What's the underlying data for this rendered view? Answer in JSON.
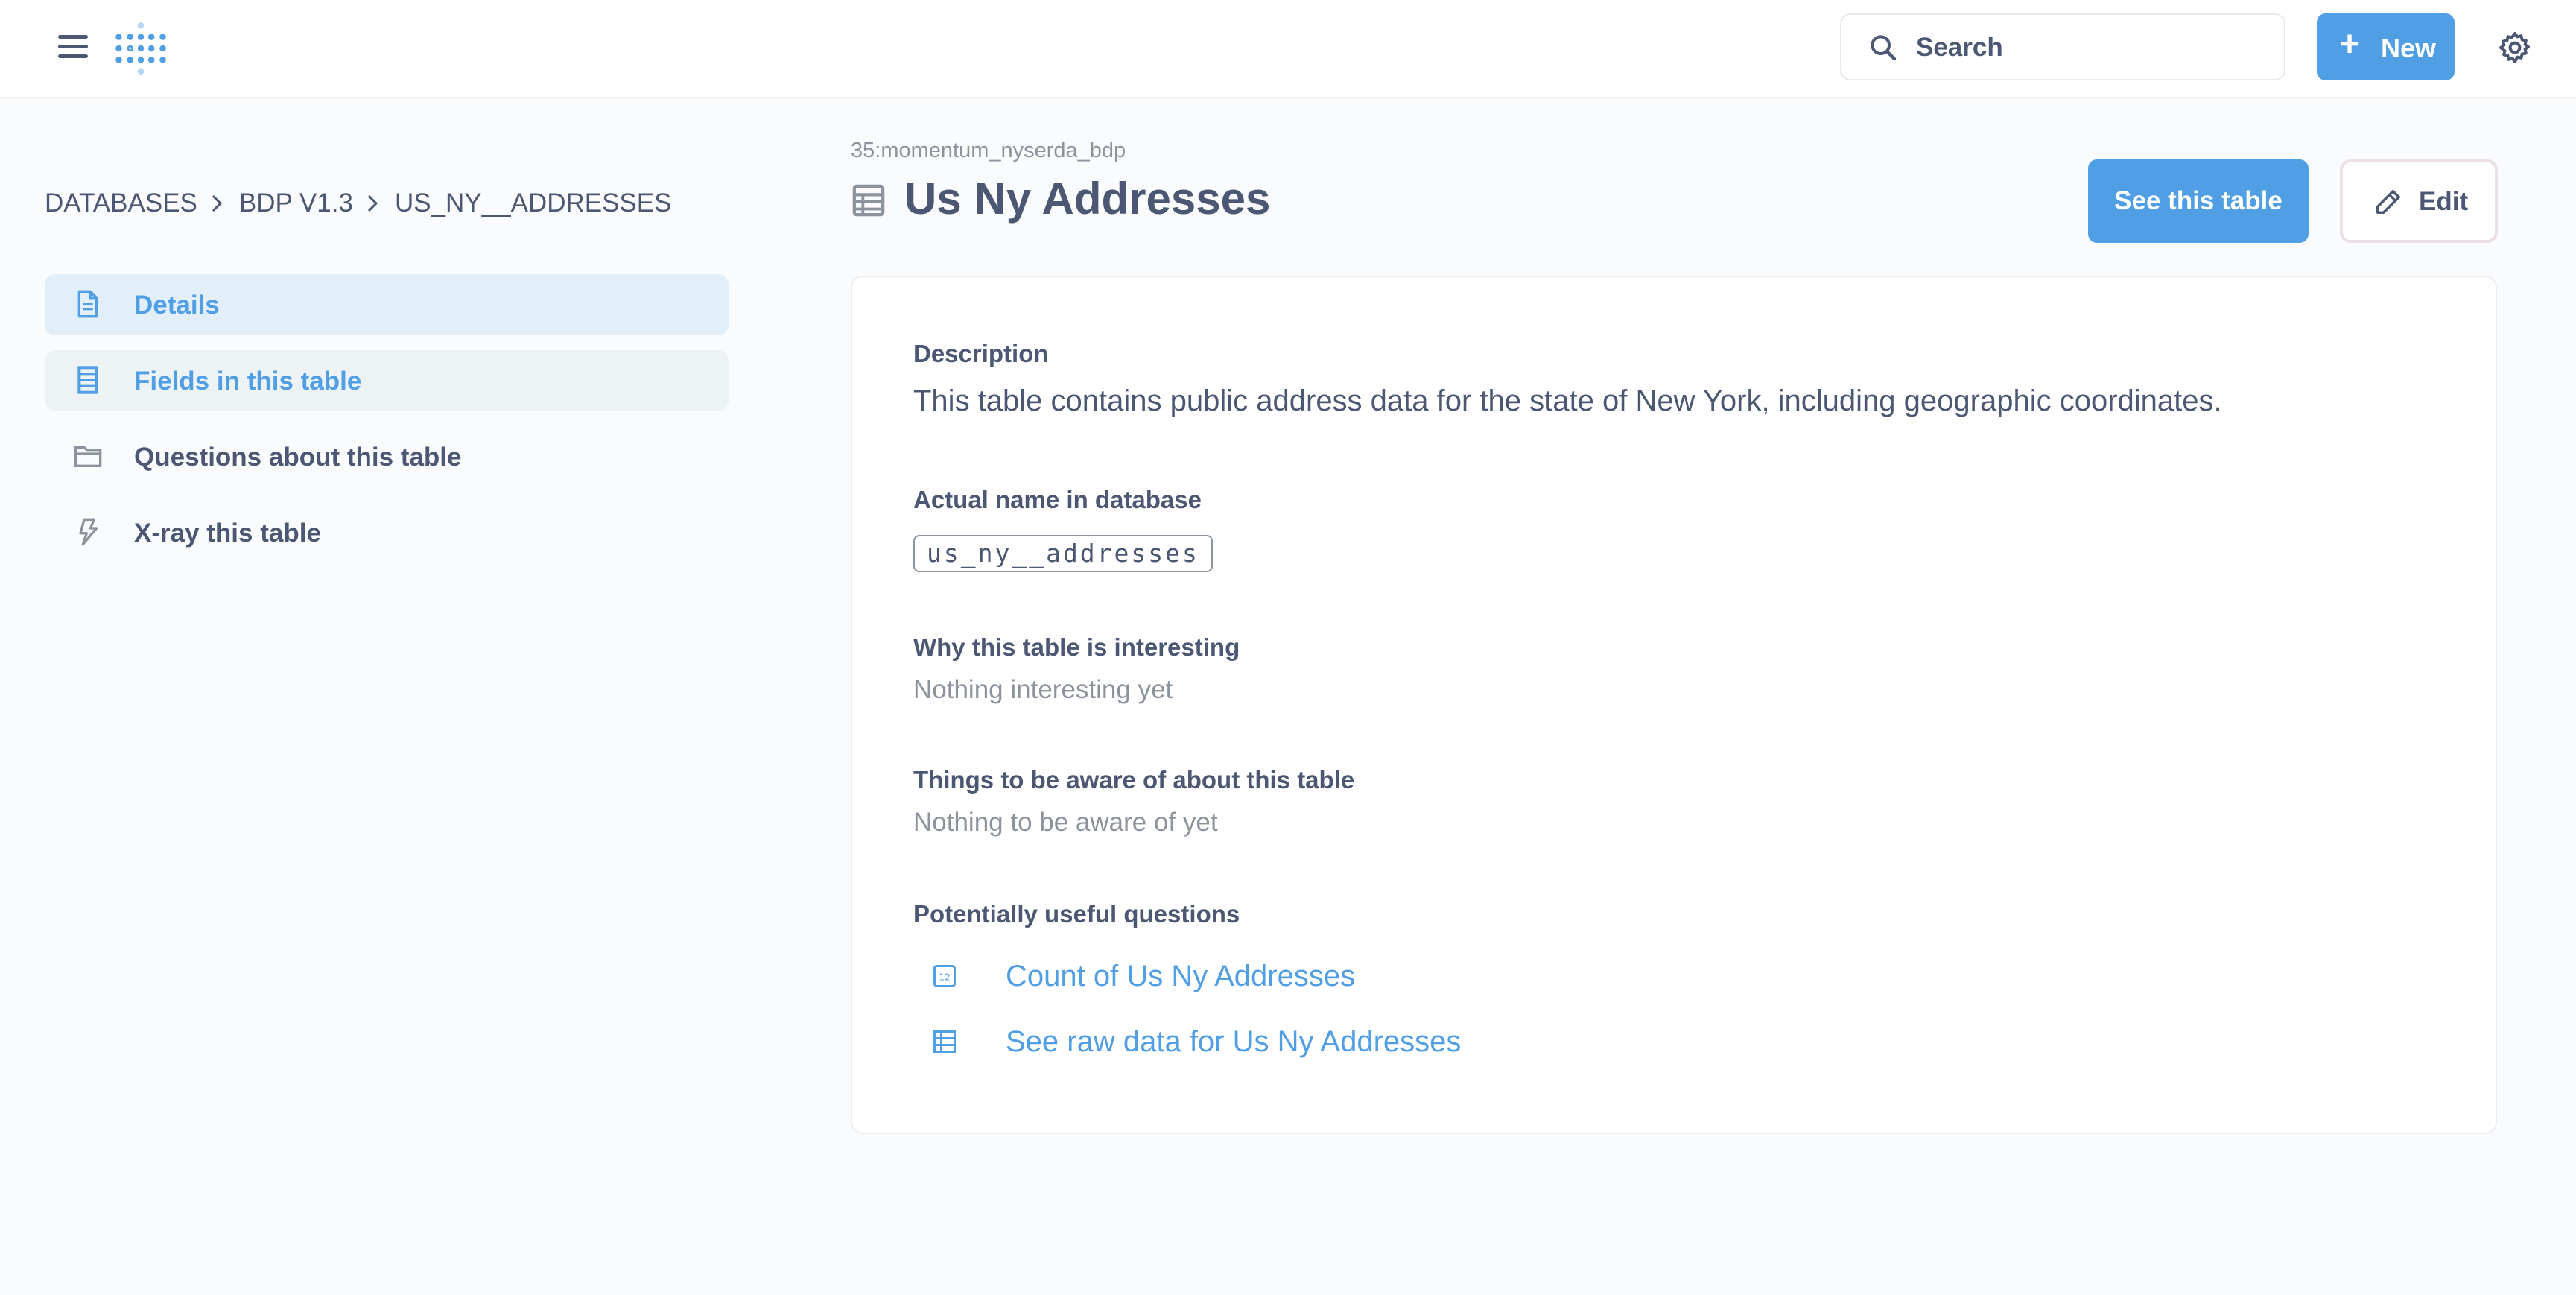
{
  "topbar": {
    "search_placeholder": "Search",
    "new_button": "New",
    "icons": {
      "menu": "hamburger-icon",
      "logo": "metabase-logo",
      "search": "search-icon",
      "add": "plus-icon",
      "settings": "gear-icon"
    }
  },
  "breadcrumb": {
    "items": [
      "DATABASES",
      "BDP V1.3",
      "US_NY__ADDRESSES"
    ]
  },
  "sidebar": {
    "items": [
      {
        "label": "Details",
        "icon": "document-icon",
        "state": "active"
      },
      {
        "label": "Fields in this table",
        "icon": "list-icon",
        "state": "hover"
      },
      {
        "label": "Questions about this table",
        "icon": "folder-icon",
        "state": "default"
      },
      {
        "label": "X-ray this table",
        "icon": "bolt-icon",
        "state": "default"
      }
    ]
  },
  "header": {
    "db_path": "35:momentum_nyserda_bdp",
    "title": "Us Ny Addresses",
    "title_icon": "table-icon",
    "see_button": "See this table",
    "edit_button": "Edit",
    "edit_icon": "pencil-icon"
  },
  "details": {
    "description_label": "Description",
    "description_value": "This table contains public address data for the state of New York, including geographic coordinates.",
    "actual_name_label": "Actual name in database",
    "actual_name_value": "us_ny__addresses",
    "interesting_label": "Why this table is interesting",
    "interesting_value": "Nothing interesting yet",
    "caveats_label": "Things to be aware of about this table",
    "caveats_value": "Nothing to be aware of yet",
    "questions_label": "Potentially useful questions",
    "questions": [
      {
        "label": "Count of Us Ny Addresses",
        "icon": "number-icon"
      },
      {
        "label": "See raw data for Us Ny Addresses",
        "icon": "table-icon"
      }
    ]
  },
  "colors": {
    "brand": "#509ee3",
    "text_dark": "#4c5773",
    "text_light": "#8d939d",
    "background": "#f9fbfc",
    "nav_active_bg": "#e2eff9"
  }
}
